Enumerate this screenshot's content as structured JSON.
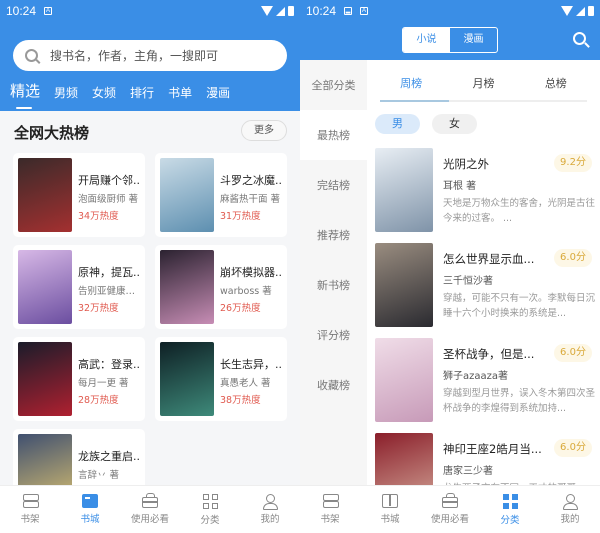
{
  "status_bar": {
    "time": "10:24"
  },
  "left": {
    "search_placeholder": "搜书名，作者，主角，一搜即可",
    "top_tabs": [
      "精选",
      "男频",
      "女频",
      "排行",
      "书单",
      "漫画"
    ],
    "active_top_tab": 0,
    "section_title": "全网大热榜",
    "more_label": "更多",
    "books": [
      {
        "title": "开局赚个邻...",
        "author": "泡面级厨师 著",
        "heat": "34万热度",
        "cover_colors": [
          "#3a2a2a",
          "#a43030"
        ]
      },
      {
        "title": "斗罗之冰魔...",
        "author": "麻酱热干面 著",
        "heat": "31万热度",
        "cover_colors": [
          "#c9dbe6",
          "#5d8fb0"
        ]
      },
      {
        "title": "原神，提瓦...",
        "author": "告别亚健康的...",
        "heat": "32万热度",
        "cover_colors": [
          "#d7b8e6",
          "#6b4ea0"
        ]
      },
      {
        "title": "崩坏模拟器...",
        "author": "warboss 著",
        "heat": "26万热度",
        "cover_colors": [
          "#2b2230",
          "#c78db5"
        ]
      },
      {
        "title": "高武：登录...",
        "author": "每月一更 著",
        "heat": "28万热度",
        "cover_colors": [
          "#1a1c2a",
          "#b02030"
        ]
      },
      {
        "title": "长生志异，...",
        "author": "真愚老人 著",
        "heat": "38万热度",
        "cover_colors": [
          "#0e1f24",
          "#3e8a7a"
        ]
      },
      {
        "title": "龙族之重启...",
        "author": "言辞丷 著",
        "heat": "",
        "cover_colors": [
          "#405070",
          "#d9c070"
        ]
      }
    ]
  },
  "right": {
    "segment": [
      "小说",
      "漫画"
    ],
    "active_segment": 0,
    "sidebar": [
      "全部分类",
      "最热榜",
      "完结榜",
      "推荐榜",
      "新书榜",
      "评分榜",
      "收藏榜"
    ],
    "active_sidebar": 1,
    "rank_tabs": [
      "周榜",
      "月榜",
      "总榜"
    ],
    "active_rank_tab": 0,
    "gender": [
      "男",
      "女"
    ],
    "active_gender": 0,
    "ranks": [
      {
        "title": "光阴之外",
        "author": "耳根 著",
        "score": "9.2分",
        "desc": "天地是万物众生的客舍，光阴是古往今来的过客。 ...",
        "cover_colors": [
          "#e8eef4",
          "#7f93a8"
        ]
      },
      {
        "title": "怎么世界显示血...",
        "author": "三千恒沙著",
        "score": "6.0分",
        "desc": "穿越，可能不只有一次。李默每日沉睡十六个小时换来的系统是...",
        "cover_colors": [
          "#9a8d80",
          "#2a2a30"
        ]
      },
      {
        "title": "圣杯战争，但是...",
        "author": "狮子azaaza著",
        "score": "6.0分",
        "desc": "穿越到型月世界，误入冬木第四次圣杯战争的李煌得到系统加持...",
        "cover_colors": [
          "#f0dde8",
          "#c79ab8"
        ]
      },
      {
        "title": "神印王座2皓月当...",
        "author": "唐家三少著",
        "score": "6.0分",
        "desc": "龙生两子亦有不同，天才的哥哥...",
        "cover_colors": [
          "#8a1e2a",
          "#d8b0a0"
        ]
      }
    ]
  },
  "tabbar": {
    "labels": [
      "书架",
      "书城",
      "使用必看",
      "分类",
      "我的"
    ],
    "left_active": 1,
    "right_active": 3
  },
  "colors": {
    "brand": "#3a8ee6",
    "heat": "#e05a4f",
    "score": "#d9a93a"
  }
}
